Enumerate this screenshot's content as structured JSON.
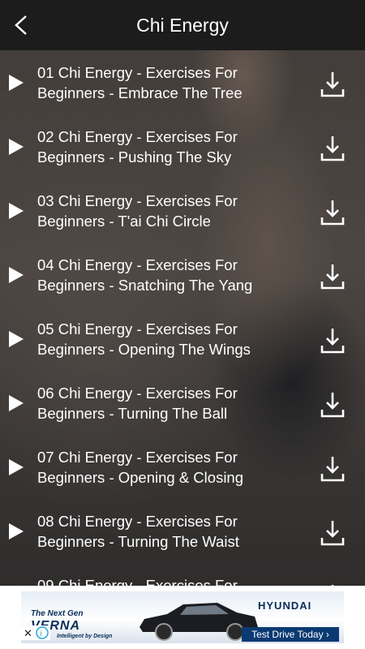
{
  "header": {
    "title": "Chi Energy"
  },
  "tracks": [
    {
      "title": "01 Chi Energy - Exercises For Beginners - Embrace The Tree"
    },
    {
      "title": "02 Chi Energy - Exercises For Beginners - Pushing The Sky"
    },
    {
      "title": "03 Chi Energy - Exercises For Beginners - T'ai Chi Circle"
    },
    {
      "title": "04 Chi Energy - Exercises For Beginners - Snatching The Yang"
    },
    {
      "title": "05 Chi Energy - Exercises For Beginners - Opening The Wings"
    },
    {
      "title": "06 Chi Energy - Exercises For Beginners - Turning The Ball"
    },
    {
      "title": "07 Chi Energy - Exercises For Beginners - Opening & Closing"
    },
    {
      "title": "08 Chi Energy - Exercises For Beginners - Turning The Waist"
    },
    {
      "title": "09 Chi Energy - Exercises For"
    }
  ],
  "ad": {
    "tagline": "The Next Gen",
    "model": "VERNA",
    "subline": "Intelligent by Design",
    "brand": "HYUNDAI",
    "cta": "Test Drive Today ›"
  },
  "icons": {
    "back": "chevron-left-icon",
    "play": "play-icon",
    "download": "download-icon",
    "adchoices": "adchoices-icon"
  },
  "colors": {
    "header_bg": "#1c1c1c",
    "text": "#ffffff",
    "ad_cta": "#0b3a73"
  }
}
